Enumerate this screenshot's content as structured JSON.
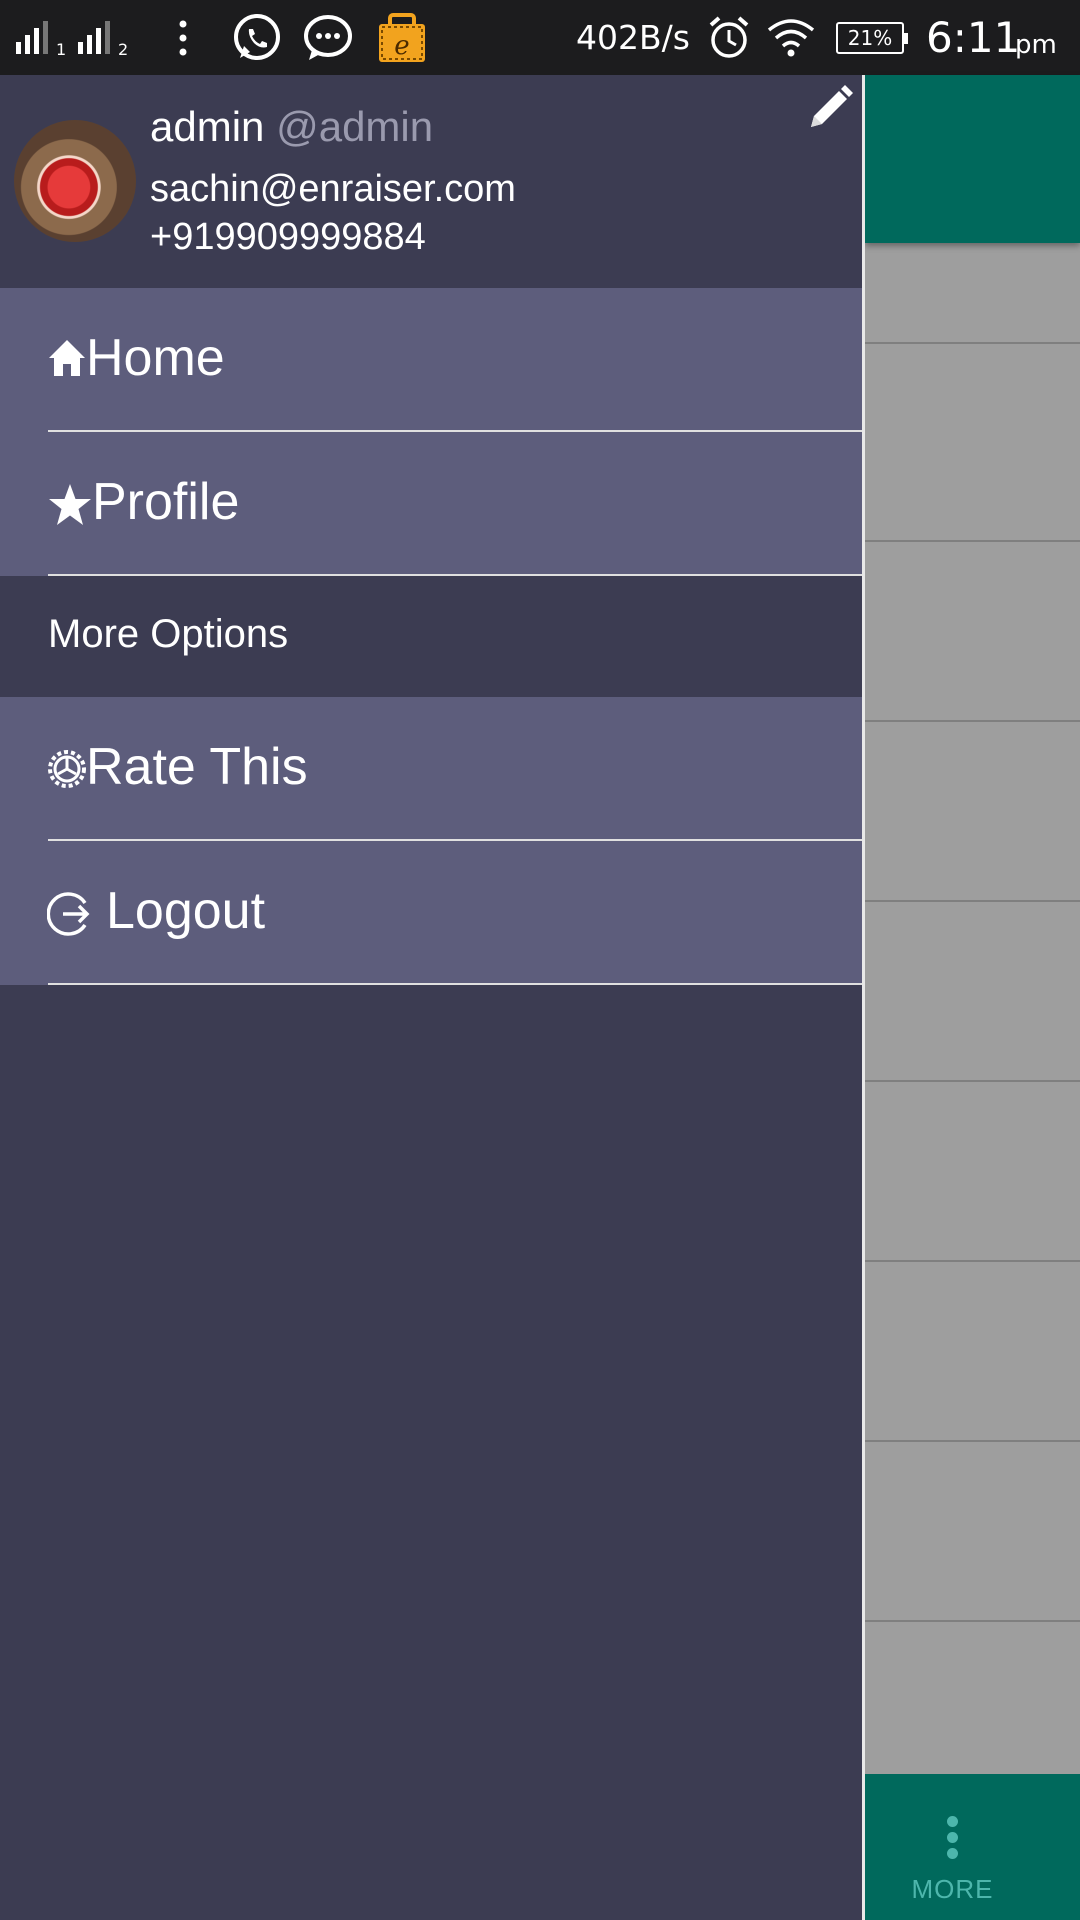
{
  "status_bar": {
    "sim1_index": "1",
    "sim2_index": "2",
    "network_speed": "402B/s",
    "battery_percent": "21%",
    "time": "6:11",
    "time_suffix": "pm",
    "notification_icons": [
      "whatsapp-icon",
      "messages-icon",
      "e-shop-icon"
    ]
  },
  "drawer": {
    "user": {
      "name": "admin",
      "handle": "@admin",
      "email": "sachin@enraiser.com",
      "phone": "+919909999884"
    },
    "menu_items": [
      {
        "label": "Home",
        "icon": "home-icon"
      },
      {
        "label": "Profile",
        "icon": "star-icon"
      }
    ],
    "section_title": "More Options",
    "more_items": [
      {
        "label": "Rate This",
        "icon": "settings-icon"
      },
      {
        "label": "Logout",
        "icon": "logout-icon"
      }
    ]
  },
  "background_app": {
    "more_label": "MORE"
  },
  "colors": {
    "drawer_bg": "#3c3c52",
    "menu_item_bg": "#5d5d7c",
    "app_toolbar": "#00695c",
    "status_bar": "#1c1c1e"
  }
}
